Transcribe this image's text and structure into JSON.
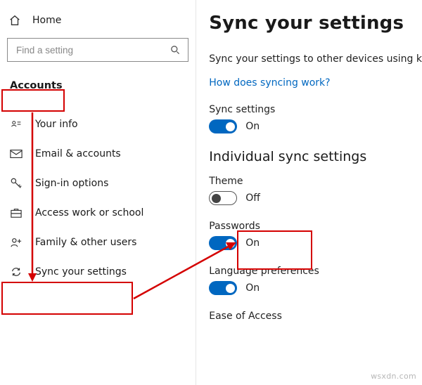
{
  "left": {
    "home": "Home",
    "search_placeholder": "Find a setting",
    "section": "Accounts",
    "items": [
      {
        "label": "Your info"
      },
      {
        "label": "Email & accounts"
      },
      {
        "label": "Sign-in options"
      },
      {
        "label": "Access work or school"
      },
      {
        "label": "Family & other users"
      },
      {
        "label": "Sync your settings"
      }
    ]
  },
  "right": {
    "title": "Sync your settings",
    "desc": "Sync your settings to other devices using k",
    "link": "How does syncing work?",
    "sync_label": "Sync settings",
    "sync_state": "On",
    "group": "Individual sync settings",
    "items": [
      {
        "label": "Theme",
        "state": "Off",
        "on": false
      },
      {
        "label": "Passwords",
        "state": "On",
        "on": true
      },
      {
        "label": "Language preferences",
        "state": "On",
        "on": true
      },
      {
        "label": "Ease of Access",
        "state": "",
        "on": null
      }
    ]
  },
  "watermark": "wsxdn.com"
}
